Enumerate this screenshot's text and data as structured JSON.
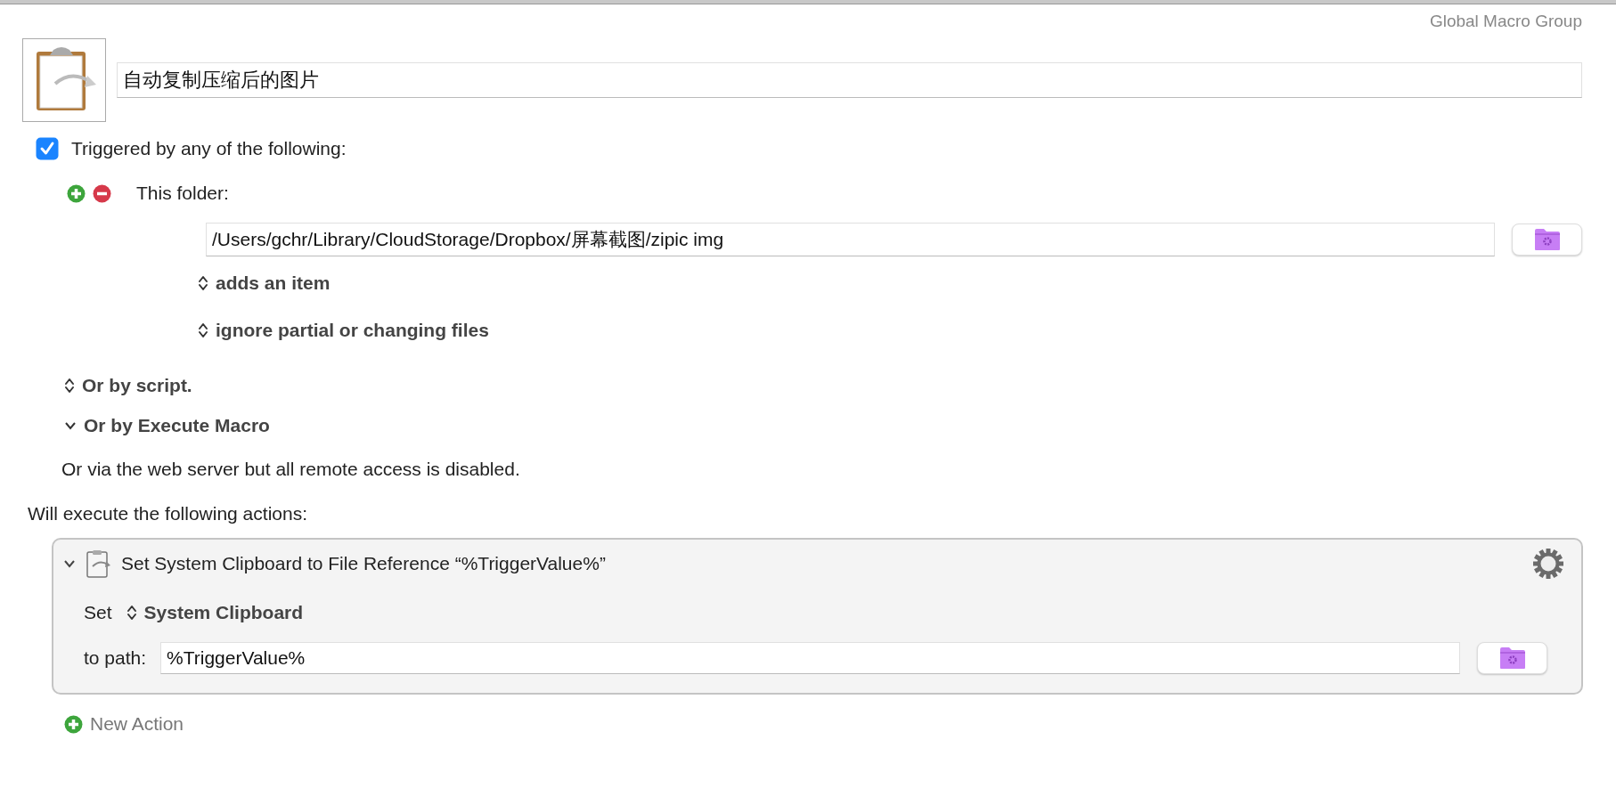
{
  "group_label": "Global Macro Group",
  "macro": {
    "name": "自动复制压缩后的图片"
  },
  "triggers": {
    "enabled": true,
    "label": "Triggered by any of the following:",
    "items": [
      {
        "label": "This folder:",
        "path": "/Users/gchr/Library/CloudStorage/Dropbox/屏幕截图/zipic img",
        "options": [
          "adds an item",
          "ignore partial or changing files"
        ]
      }
    ]
  },
  "alternatives": [
    {
      "kind": "popup",
      "label": "Or by script."
    },
    {
      "kind": "disclosure",
      "expanded": true,
      "label": "Or by Execute Macro"
    }
  ],
  "web_server_note": "Or via the web server but all remote access is disabled.",
  "actions_label": "Will execute the following actions:",
  "actions": [
    {
      "expanded": true,
      "title": "Set System Clipboard to File Reference “%TriggerValue%”",
      "set_label": "Set",
      "target": "System Clipboard",
      "path_label": "to path:",
      "path": "%TriggerValue%"
    }
  ],
  "new_action": "New Action"
}
